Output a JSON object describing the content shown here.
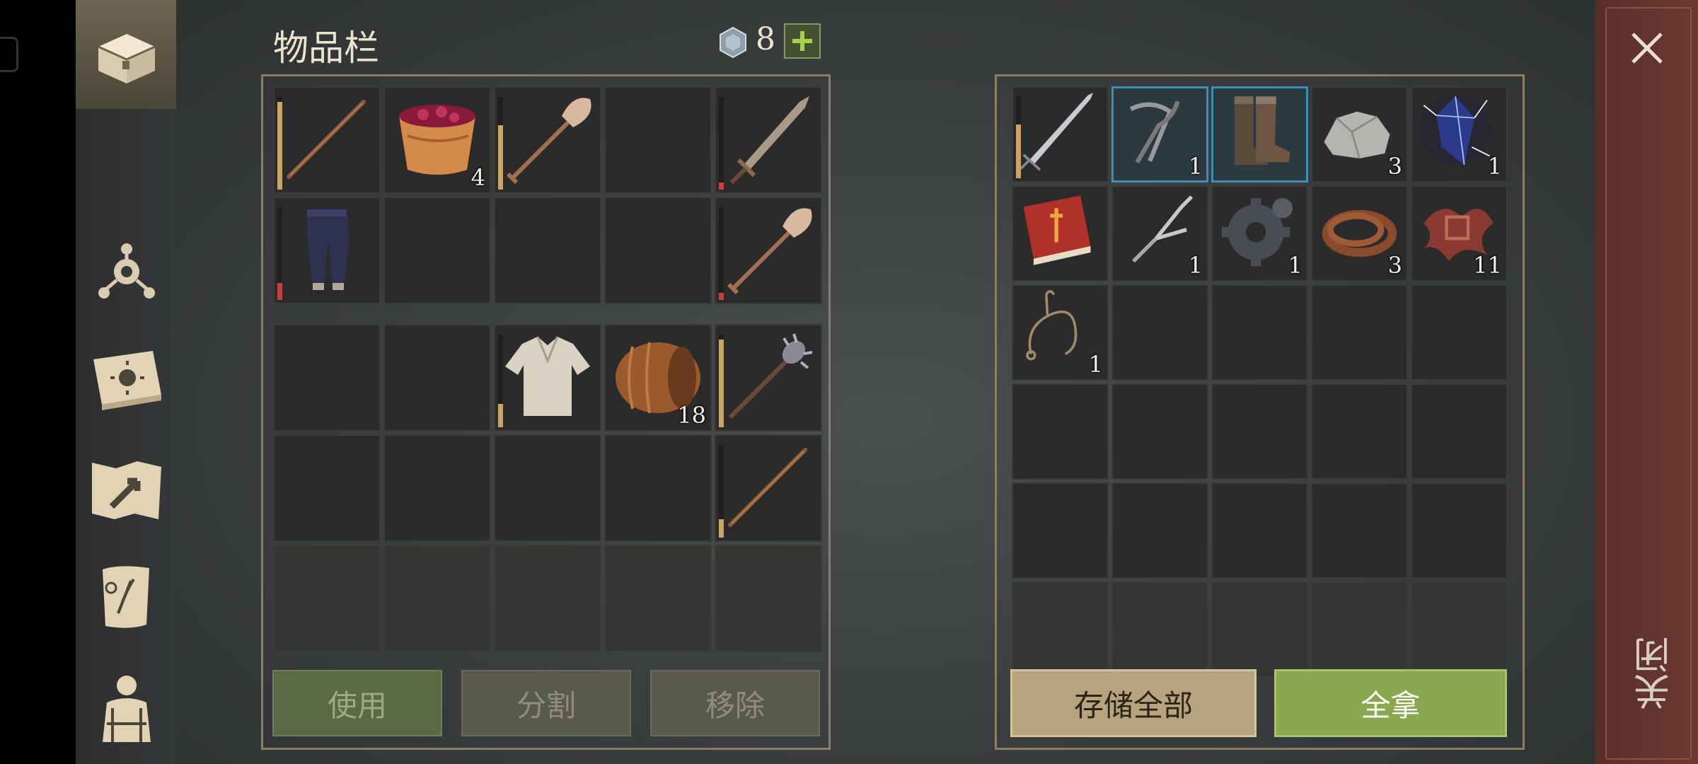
{
  "header": {
    "title": "物品栏",
    "currency_count": "8",
    "currency_icon": "gem-coin-icon",
    "plus_icon": "plus-icon"
  },
  "close": {
    "label": "关闭",
    "icon": "close-x-icon"
  },
  "sidebar": {
    "items": [
      {
        "name": "inventory-chest",
        "icon": "chest-icon",
        "active": true
      },
      {
        "name": "skills",
        "icon": "skill-tree-icon"
      },
      {
        "name": "journal",
        "icon": "sun-book-icon"
      },
      {
        "name": "map",
        "icon": "map-icon"
      },
      {
        "name": "quests",
        "icon": "scroll-icon"
      },
      {
        "name": "character",
        "icon": "character-icon"
      }
    ]
  },
  "left_inventory": {
    "hotbar": [
      {
        "item": "wooden-staff",
        "durability": 0.95,
        "dur_color": "#c9a46a"
      },
      {
        "item": "berry-basket",
        "count": "4"
      },
      {
        "item": "shovel",
        "durability": 0.7,
        "dur_color": "#c9a46a"
      },
      {
        "item": ""
      },
      {
        "item": "bronze-sword",
        "durability": 0.08,
        "dur_color": "#c0443a"
      },
      {
        "item": "dark-pants",
        "durability": 0.18,
        "dur_color": "#c0443a"
      },
      {
        "item": ""
      },
      {
        "item": ""
      },
      {
        "item": ""
      },
      {
        "item": "shovel",
        "durability": 0.08,
        "dur_color": "#c0443a"
      }
    ],
    "backpack": [
      {
        "item": ""
      },
      {
        "item": ""
      },
      {
        "item": "cloth-shirt",
        "durability": 0.25,
        "dur_color": "#c9a46a"
      },
      {
        "item": "barrel",
        "count": "18"
      },
      {
        "item": "spiked-mace",
        "durability": 0.95,
        "dur_color": "#c9a46a"
      },
      {
        "item": ""
      },
      {
        "item": ""
      },
      {
        "item": ""
      },
      {
        "item": ""
      },
      {
        "item": "wooden-staff",
        "durability": 0.2,
        "dur_color": "#c9a46a"
      },
      {
        "item": "",
        "dim": true
      },
      {
        "item": "",
        "dim": true
      },
      {
        "item": "",
        "dim": true
      },
      {
        "item": "",
        "dim": true
      },
      {
        "item": "",
        "dim": true
      }
    ],
    "buttons": {
      "use": "使用",
      "split": "分割",
      "remove": "移除"
    }
  },
  "container": {
    "slots": [
      {
        "item": "long-sword",
        "durability": 0.65,
        "dur_color": "#c9a46a"
      },
      {
        "item": "pliers",
        "count": "1",
        "selected": true
      },
      {
        "item": "leather-boots",
        "selected": true
      },
      {
        "item": "stone-ore",
        "count": "3"
      },
      {
        "item": "crystal-shard",
        "count": "1"
      },
      {
        "item": "red-book"
      },
      {
        "item": "tuning-fork",
        "count": "1"
      },
      {
        "item": "gear-parts",
        "count": "1"
      },
      {
        "item": "leather-strap",
        "count": "3"
      },
      {
        "item": "red-fibers",
        "count": "11"
      },
      {
        "item": "rope-coil",
        "count": "1"
      },
      {
        "item": ""
      },
      {
        "item": ""
      },
      {
        "item": ""
      },
      {
        "item": ""
      },
      {
        "item": ""
      },
      {
        "item": ""
      },
      {
        "item": ""
      },
      {
        "item": ""
      },
      {
        "item": ""
      },
      {
        "item": ""
      },
      {
        "item": ""
      },
      {
        "item": ""
      },
      {
        "item": ""
      },
      {
        "item": ""
      },
      {
        "item": "",
        "dim": true
      },
      {
        "item": "",
        "dim": true
      },
      {
        "item": "",
        "dim": true
      },
      {
        "item": "",
        "dim": true
      },
      {
        "item": "",
        "dim": true
      }
    ],
    "buttons": {
      "store_all": "存储全部",
      "take_all": "全拿"
    }
  }
}
